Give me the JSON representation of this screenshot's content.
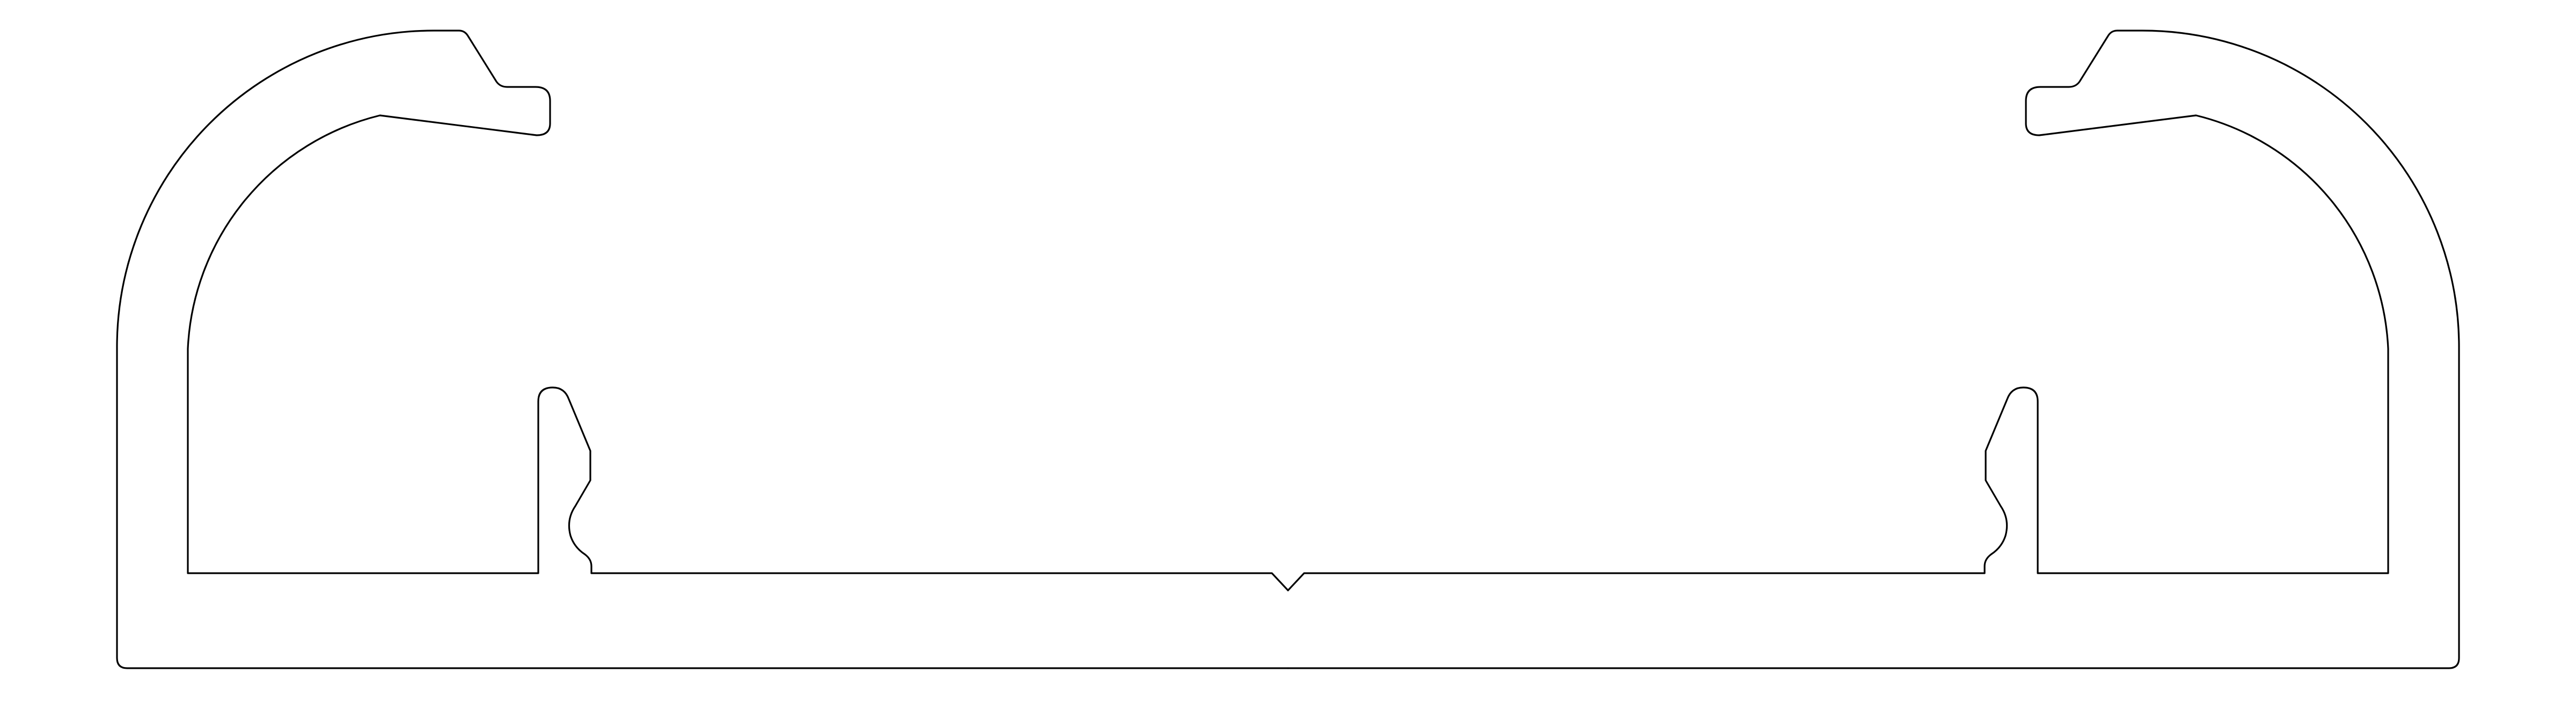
{
  "drawing": {
    "subject": "",
    "colors": {
      "background": "#ffffff",
      "line": "#000000"
    }
  }
}
